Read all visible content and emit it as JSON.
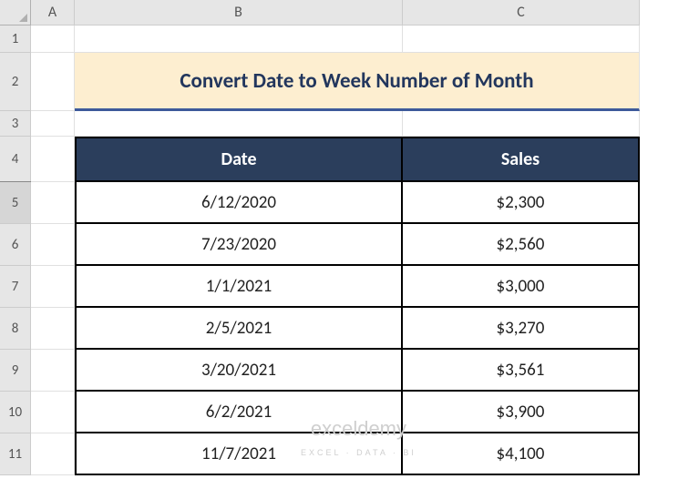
{
  "columns": [
    "A",
    "B",
    "C"
  ],
  "rows": [
    "1",
    "2",
    "3",
    "4",
    "5",
    "6",
    "7",
    "8",
    "9",
    "10",
    "11"
  ],
  "selected_row": "5",
  "title": "Convert Date to Week Number of Month",
  "table": {
    "headers": [
      "Date",
      "Sales"
    ],
    "rows": [
      {
        "date": "6/12/2020",
        "sales": "$2,300"
      },
      {
        "date": "7/23/2020",
        "sales": "$2,560"
      },
      {
        "date": "1/1/2021",
        "sales": "$3,000"
      },
      {
        "date": "2/5/2021",
        "sales": "$3,270"
      },
      {
        "date": "3/20/2021",
        "sales": "$3,561"
      },
      {
        "date": "6/2/2021",
        "sales": "$3,900"
      },
      {
        "date": "11/7/2021",
        "sales": "$4,100"
      }
    ]
  },
  "watermark": {
    "main": "exceldemy",
    "sub": "EXCEL · DATA · BI"
  }
}
